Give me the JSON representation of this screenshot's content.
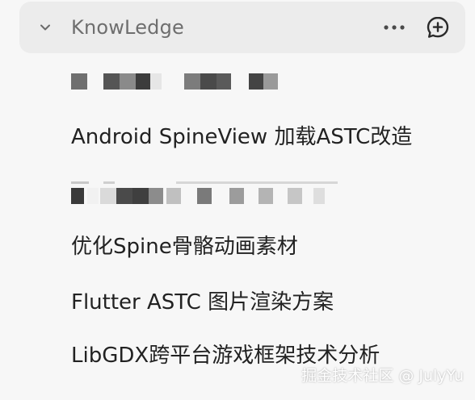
{
  "section": {
    "title": "KnowLedge",
    "expanded": true,
    "chevron_icon": "chevron-down-icon",
    "more_icon": "more-horizontal-icon",
    "add_icon": "add-chat-icon"
  },
  "items": [
    {
      "label": "",
      "redacted": true
    },
    {
      "label": "Android SpineView 加载ASTC改造",
      "redacted": false
    },
    {
      "label": "",
      "redacted": true
    },
    {
      "label": "优化Spine骨骼动画素材",
      "redacted": false
    },
    {
      "label": "Flutter ASTC 图片渲染方案",
      "redacted": false
    },
    {
      "label": "LibGDX跨平台游戏框架技术分析",
      "redacted": false
    }
  ],
  "watermark": "掘金技术社区 @ JulyYu",
  "colors": {
    "background": "#f7f7f7",
    "header_background": "#ececec",
    "title": "#6e6e6e",
    "item_text": "#222222"
  }
}
